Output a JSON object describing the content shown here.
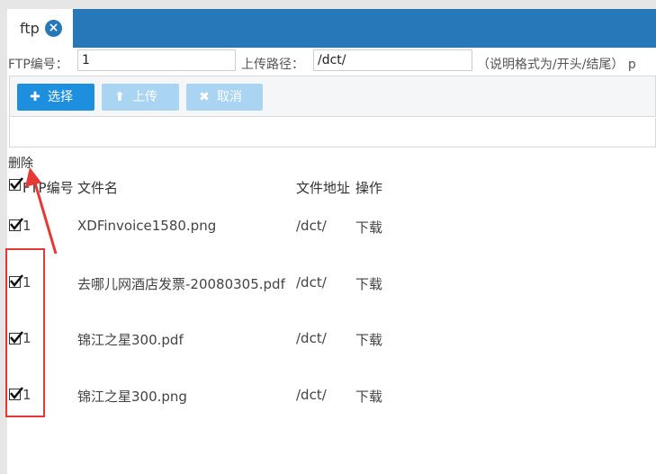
{
  "tab": {
    "label": "ftp"
  },
  "form": {
    "ftp_id_label": "FTP编号：",
    "ftp_id_value": "1",
    "upload_path_label": "上传路径：",
    "upload_path_value": "/dct/",
    "hint": "（说明格式为/开头/结尾） p"
  },
  "toolbar": {
    "select_label": "选择",
    "upload_label": "上传",
    "cancel_label": "取消"
  },
  "delete_label": "删除",
  "table": {
    "headers": {
      "ftp_id": "FTP编号",
      "file_name": "文件名",
      "file_address": "文件地址",
      "action": "操作"
    },
    "rows": [
      {
        "ftp_id": "1",
        "file_name": "XDFinvoice1580.png",
        "file_address": "/dct/",
        "action": "下载"
      },
      {
        "ftp_id": "1",
        "file_name": "去哪儿网酒店发票-20080305.pdf",
        "file_address": "/dct/",
        "action": "下载"
      },
      {
        "ftp_id": "1",
        "file_name": "锦江之星300.pdf",
        "file_address": "/dct/",
        "action": "下载"
      },
      {
        "ftp_id": "1",
        "file_name": "锦江之星300.png",
        "file_address": "/dct/",
        "action": "下载"
      }
    ]
  },
  "colors": {
    "header_bar": "#2778b8",
    "primary_button": "#1e8fde",
    "disabled_button": "#a9d5f3",
    "annotation": "#e53935"
  }
}
